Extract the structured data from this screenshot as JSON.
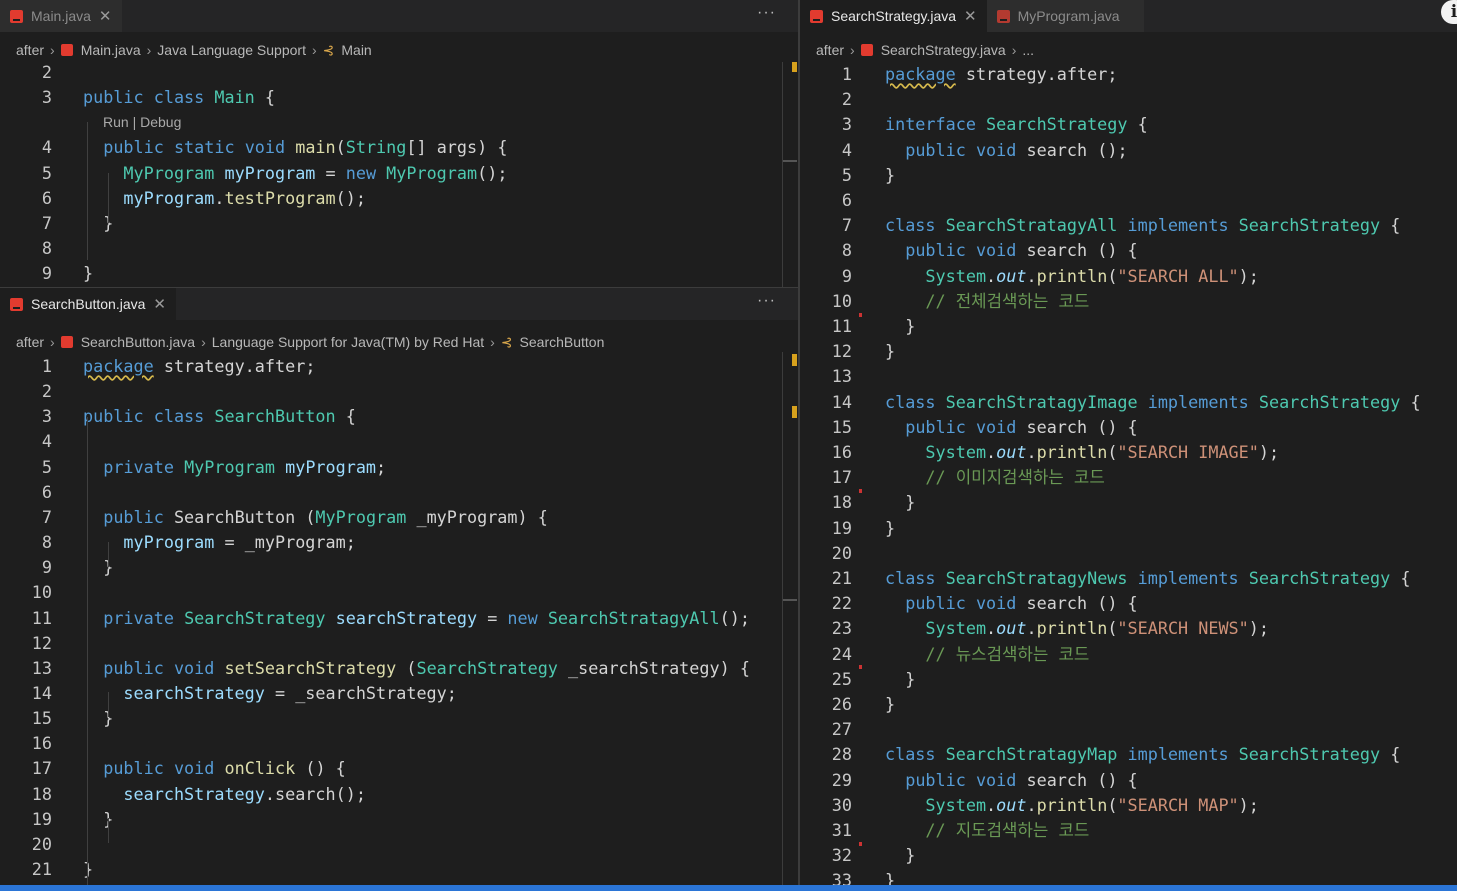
{
  "top_left": {
    "tabs": [
      {
        "label": "Main.java",
        "active": false
      }
    ],
    "breadcrumb": [
      "after",
      "Main.java",
      "Java Language Support",
      "Main"
    ],
    "codelens": "Run | Debug",
    "code": [
      {
        "ln": "2",
        "t": ""
      },
      {
        "ln": "3",
        "t": "public class Main {"
      },
      {
        "ln": "4",
        "t": "  public static void main(String[] args) {"
      },
      {
        "ln": "5",
        "t": "    MyProgram myProgram = new MyProgram();"
      },
      {
        "ln": "6",
        "t": "    myProgram.testProgram();"
      },
      {
        "ln": "7",
        "t": "  }"
      },
      {
        "ln": "8",
        "t": ""
      },
      {
        "ln": "9",
        "t": "}"
      }
    ]
  },
  "bottom_left": {
    "tabs": [
      {
        "label": "SearchButton.java",
        "active": true
      }
    ],
    "breadcrumb": [
      "after",
      "SearchButton.java",
      "Language Support for Java(TM) by Red Hat",
      "SearchButton"
    ],
    "code": [
      {
        "ln": "1",
        "t": "package strategy.after;"
      },
      {
        "ln": "2",
        "t": ""
      },
      {
        "ln": "3",
        "t": "public class SearchButton {"
      },
      {
        "ln": "4",
        "t": ""
      },
      {
        "ln": "5",
        "t": "  private MyProgram myProgram;"
      },
      {
        "ln": "6",
        "t": ""
      },
      {
        "ln": "7",
        "t": "  public SearchButton (MyProgram _myProgram) {"
      },
      {
        "ln": "8",
        "t": "    myProgram = _myProgram;"
      },
      {
        "ln": "9",
        "t": "  }"
      },
      {
        "ln": "10",
        "t": ""
      },
      {
        "ln": "11",
        "t": "  private SearchStrategy searchStrategy = new SearchStratagyAll();"
      },
      {
        "ln": "12",
        "t": ""
      },
      {
        "ln": "13",
        "t": "  public void setSearchStrategy (SearchStrategy _searchStrategy) {"
      },
      {
        "ln": "14",
        "t": "    searchStrategy = _searchStrategy;"
      },
      {
        "ln": "15",
        "t": "  }"
      },
      {
        "ln": "16",
        "t": ""
      },
      {
        "ln": "17",
        "t": "  public void onClick () {"
      },
      {
        "ln": "18",
        "t": "    searchStrategy.search();"
      },
      {
        "ln": "19",
        "t": "  }"
      },
      {
        "ln": "20",
        "t": ""
      },
      {
        "ln": "21",
        "t": "}"
      }
    ]
  },
  "right": {
    "tabs": [
      {
        "label": "SearchStrategy.java",
        "active": true
      },
      {
        "label": "MyProgram.java",
        "active": false
      }
    ],
    "breadcrumb": [
      "after",
      "SearchStrategy.java",
      "..."
    ],
    "code": [
      {
        "ln": "1",
        "t": "package strategy.after;"
      },
      {
        "ln": "2",
        "t": ""
      },
      {
        "ln": "3",
        "t": "interface SearchStrategy {"
      },
      {
        "ln": "4",
        "t": "  public void search ();"
      },
      {
        "ln": "5",
        "t": "}"
      },
      {
        "ln": "6",
        "t": ""
      },
      {
        "ln": "7",
        "t": "class SearchStratagyAll implements SearchStrategy {"
      },
      {
        "ln": "8",
        "t": "  public void search () {"
      },
      {
        "ln": "9",
        "t": "    System.out.println(\"SEARCH ALL\");"
      },
      {
        "ln": "10",
        "t": "    // 전체검색하는 코드"
      },
      {
        "ln": "11",
        "t": "  }"
      },
      {
        "ln": "12",
        "t": "}"
      },
      {
        "ln": "13",
        "t": ""
      },
      {
        "ln": "14",
        "t": "class SearchStratagyImage implements SearchStrategy {"
      },
      {
        "ln": "15",
        "t": "  public void search () {"
      },
      {
        "ln": "16",
        "t": "    System.out.println(\"SEARCH IMAGE\");"
      },
      {
        "ln": "17",
        "t": "    // 이미지검색하는 코드"
      },
      {
        "ln": "18",
        "t": "  }"
      },
      {
        "ln": "19",
        "t": "}"
      },
      {
        "ln": "20",
        "t": ""
      },
      {
        "ln": "21",
        "t": "class SearchStratagyNews implements SearchStrategy {"
      },
      {
        "ln": "22",
        "t": "  public void search () {"
      },
      {
        "ln": "23",
        "t": "    System.out.println(\"SEARCH NEWS\");"
      },
      {
        "ln": "24",
        "t": "    // 뉴스검색하는 코드"
      },
      {
        "ln": "25",
        "t": "  }"
      },
      {
        "ln": "26",
        "t": "}"
      },
      {
        "ln": "27",
        "t": ""
      },
      {
        "ln": "28",
        "t": "class SearchStratagyMap implements SearchStrategy {"
      },
      {
        "ln": "29",
        "t": "  public void search () {"
      },
      {
        "ln": "30",
        "t": "    System.out.println(\"SEARCH MAP\");"
      },
      {
        "ln": "31",
        "t": "    // 지도검색하는 코드"
      },
      {
        "ln": "32",
        "t": "  }"
      },
      {
        "ln": "33",
        "t": "}"
      }
    ]
  },
  "colors": {
    "keyword": "#569cd6",
    "type": "#4ec9b0",
    "method": "#dcdcaa",
    "variable": "#9cdcfe",
    "string": "#ce9178",
    "comment": "#6a9955",
    "statusbar": "#2b75d6"
  },
  "icons": [
    "java-file-icon",
    "close-icon",
    "more-actions-icon",
    "symbol-class-icon",
    "info-icon"
  ]
}
